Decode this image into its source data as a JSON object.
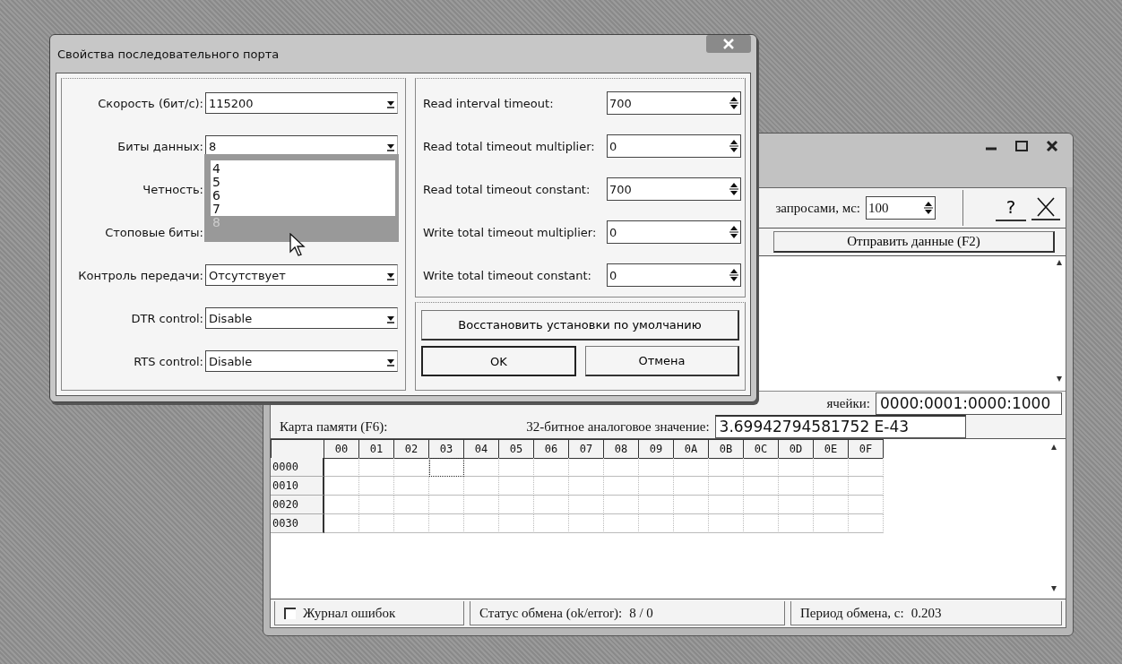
{
  "main_window": {
    "interval_label": "запросами, мс:",
    "interval_value": "100",
    "help_button": "?",
    "send_button": "Отправить данные (F2)",
    "binary_label": "ячейки:",
    "binary_value": "0000:0001:0000:1000",
    "memory_label": "Карта памяти (F6):",
    "analog_label": "32-битное аналоговое значение:",
    "analog_value": "3.69942794581752 E-43",
    "grid": {
      "columns": [
        "00",
        "01",
        "02",
        "03",
        "04",
        "05",
        "06",
        "07",
        "08",
        "09",
        "0A",
        "0B",
        "0C",
        "0D",
        "0E",
        "0F"
      ],
      "rows": [
        {
          "address": "0000",
          "cells": [
            {
              "selected": false
            },
            {
              "selected": false
            },
            {
              "selected": false
            },
            {
              "selected": true
            },
            {
              "selected": false
            },
            {
              "selected": false
            },
            {
              "selected": false
            },
            {
              "selected": false
            },
            {
              "selected": false
            },
            {
              "selected": false
            },
            {
              "selected": false
            },
            {
              "selected": false
            },
            {
              "selected": false
            },
            {
              "selected": false
            },
            {
              "selected": false
            },
            {
              "selected": false
            }
          ]
        },
        {
          "address": "0010",
          "cells": [
            {
              "selected": false
            },
            {
              "selected": false
            },
            {
              "selected": false
            },
            {
              "selected": false
            },
            {
              "selected": false
            },
            {
              "selected": false
            },
            {
              "selected": false
            },
            {
              "selected": false
            },
            {
              "selected": false
            },
            {
              "selected": false
            },
            {
              "selected": false
            },
            {
              "selected": false
            },
            {
              "selected": false
            },
            {
              "selected": false
            },
            {
              "selected": false
            },
            {
              "selected": false
            }
          ]
        },
        {
          "address": "0020",
          "cells": [
            {
              "selected": false
            },
            {
              "selected": false
            },
            {
              "selected": false
            },
            {
              "selected": false
            },
            {
              "selected": false
            },
            {
              "selected": false
            },
            {
              "selected": false
            },
            {
              "selected": false
            },
            {
              "selected": false
            },
            {
              "selected": false
            },
            {
              "selected": false
            },
            {
              "selected": false
            },
            {
              "selected": false
            },
            {
              "selected": false
            },
            {
              "selected": false
            },
            {
              "selected": false
            }
          ]
        },
        {
          "address": "0030",
          "cells": [
            {
              "selected": false
            },
            {
              "selected": false
            },
            {
              "selected": false
            },
            {
              "selected": false
            },
            {
              "selected": false
            },
            {
              "selected": false
            },
            {
              "selected": false
            },
            {
              "selected": false
            },
            {
              "selected": false
            },
            {
              "selected": false
            },
            {
              "selected": false
            },
            {
              "selected": false
            },
            {
              "selected": false
            },
            {
              "selected": false
            },
            {
              "selected": false
            },
            {
              "selected": false
            }
          ]
        }
      ]
    },
    "status_bar": {
      "error_log": {
        "label": "Журнал ошибок",
        "checked": false
      },
      "exchange_label": "Статус обмена (ok/error):",
      "exchange_value": "8 / 0",
      "period_label": "Период обмена, с:",
      "period_value": "0.203"
    }
  },
  "dialog": {
    "title": "Свойства последовательного порта",
    "left_fields": [
      {
        "label": "Скорость (бит/с):",
        "value": "115200"
      },
      {
        "label": "Биты данных:",
        "value": "8"
      },
      {
        "label": "Четность:"
      },
      {
        "label": "Стоповые биты:"
      },
      {
        "label": "Контроль передачи:",
        "value": "Отсутствует"
      },
      {
        "label": "DTR control:",
        "value": "Disable"
      },
      {
        "label": "RTS control:",
        "value": "Disable"
      }
    ],
    "dropdown_list": [
      {
        "label": "4",
        "selected": false
      },
      {
        "label": "5",
        "selected": false
      },
      {
        "label": "6",
        "selected": false
      },
      {
        "label": "7",
        "selected": false
      },
      {
        "label": "8",
        "selected": true
      }
    ],
    "right_fields": [
      {
        "label": "Read interval timeout:",
        "value": "700"
      },
      {
        "label": "Read total timeout multiplier:",
        "value": "0"
      },
      {
        "label": "Read total timeout constant:",
        "value": "700"
      },
      {
        "label": "Write total timeout multiplier:",
        "value": "0"
      },
      {
        "label": "Write total timeout constant:",
        "value": "0"
      }
    ],
    "restore_button": "Восстановить установки по умолчанию",
    "buttons": [
      {
        "label": "OK",
        "default": true
      },
      {
        "label": "Отмена",
        "default": false
      }
    ]
  }
}
